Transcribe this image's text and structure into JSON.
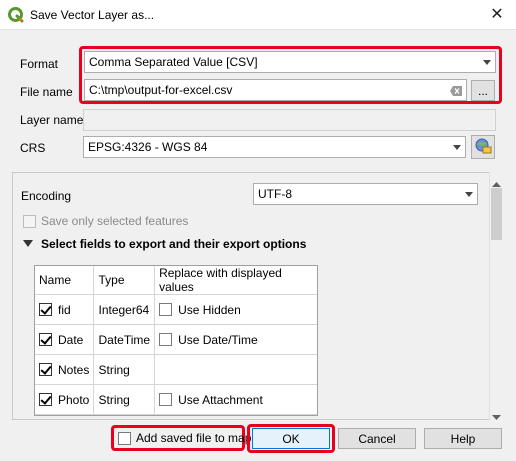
{
  "window": {
    "title": "Save Vector Layer as...",
    "app_icon": "qgis-logo-icon",
    "close_glyph": "✕"
  },
  "form": {
    "format_label": "Format",
    "format_value": "Comma Separated Value [CSV]",
    "filename_label": "File name",
    "filename_value": "C:\\tmp\\output-for-excel.csv",
    "browse_label": "...",
    "layername_label": "Layer name",
    "layername_value": "",
    "crs_label": "CRS",
    "crs_value": "EPSG:4326 - WGS 84"
  },
  "panel": {
    "encoding_label": "Encoding",
    "encoding_value": "UTF-8",
    "selected_only_label": "Save only selected features",
    "fields_section_title": "Select fields to export and their export options",
    "columns": [
      "Name",
      "Type",
      "Replace with displayed values"
    ],
    "rows": [
      {
        "checked": true,
        "name": "fid",
        "type": "Integer64",
        "replace": "Use Hidden"
      },
      {
        "checked": true,
        "name": "Date",
        "type": "DateTime",
        "replace": "Use Date/Time"
      },
      {
        "checked": true,
        "name": "Notes",
        "type": "String",
        "replace": ""
      },
      {
        "checked": true,
        "name": "Photo",
        "type": "String",
        "replace": "Use Attachment"
      }
    ]
  },
  "footer": {
    "add_to_map_label": "Add saved file to map",
    "ok_label": "OK",
    "cancel_label": "Cancel",
    "help_label": "Help"
  },
  "colors": {
    "highlight": "#e8001c",
    "qgis_green": "#589632",
    "qgis_yellow": "#ee7913"
  }
}
